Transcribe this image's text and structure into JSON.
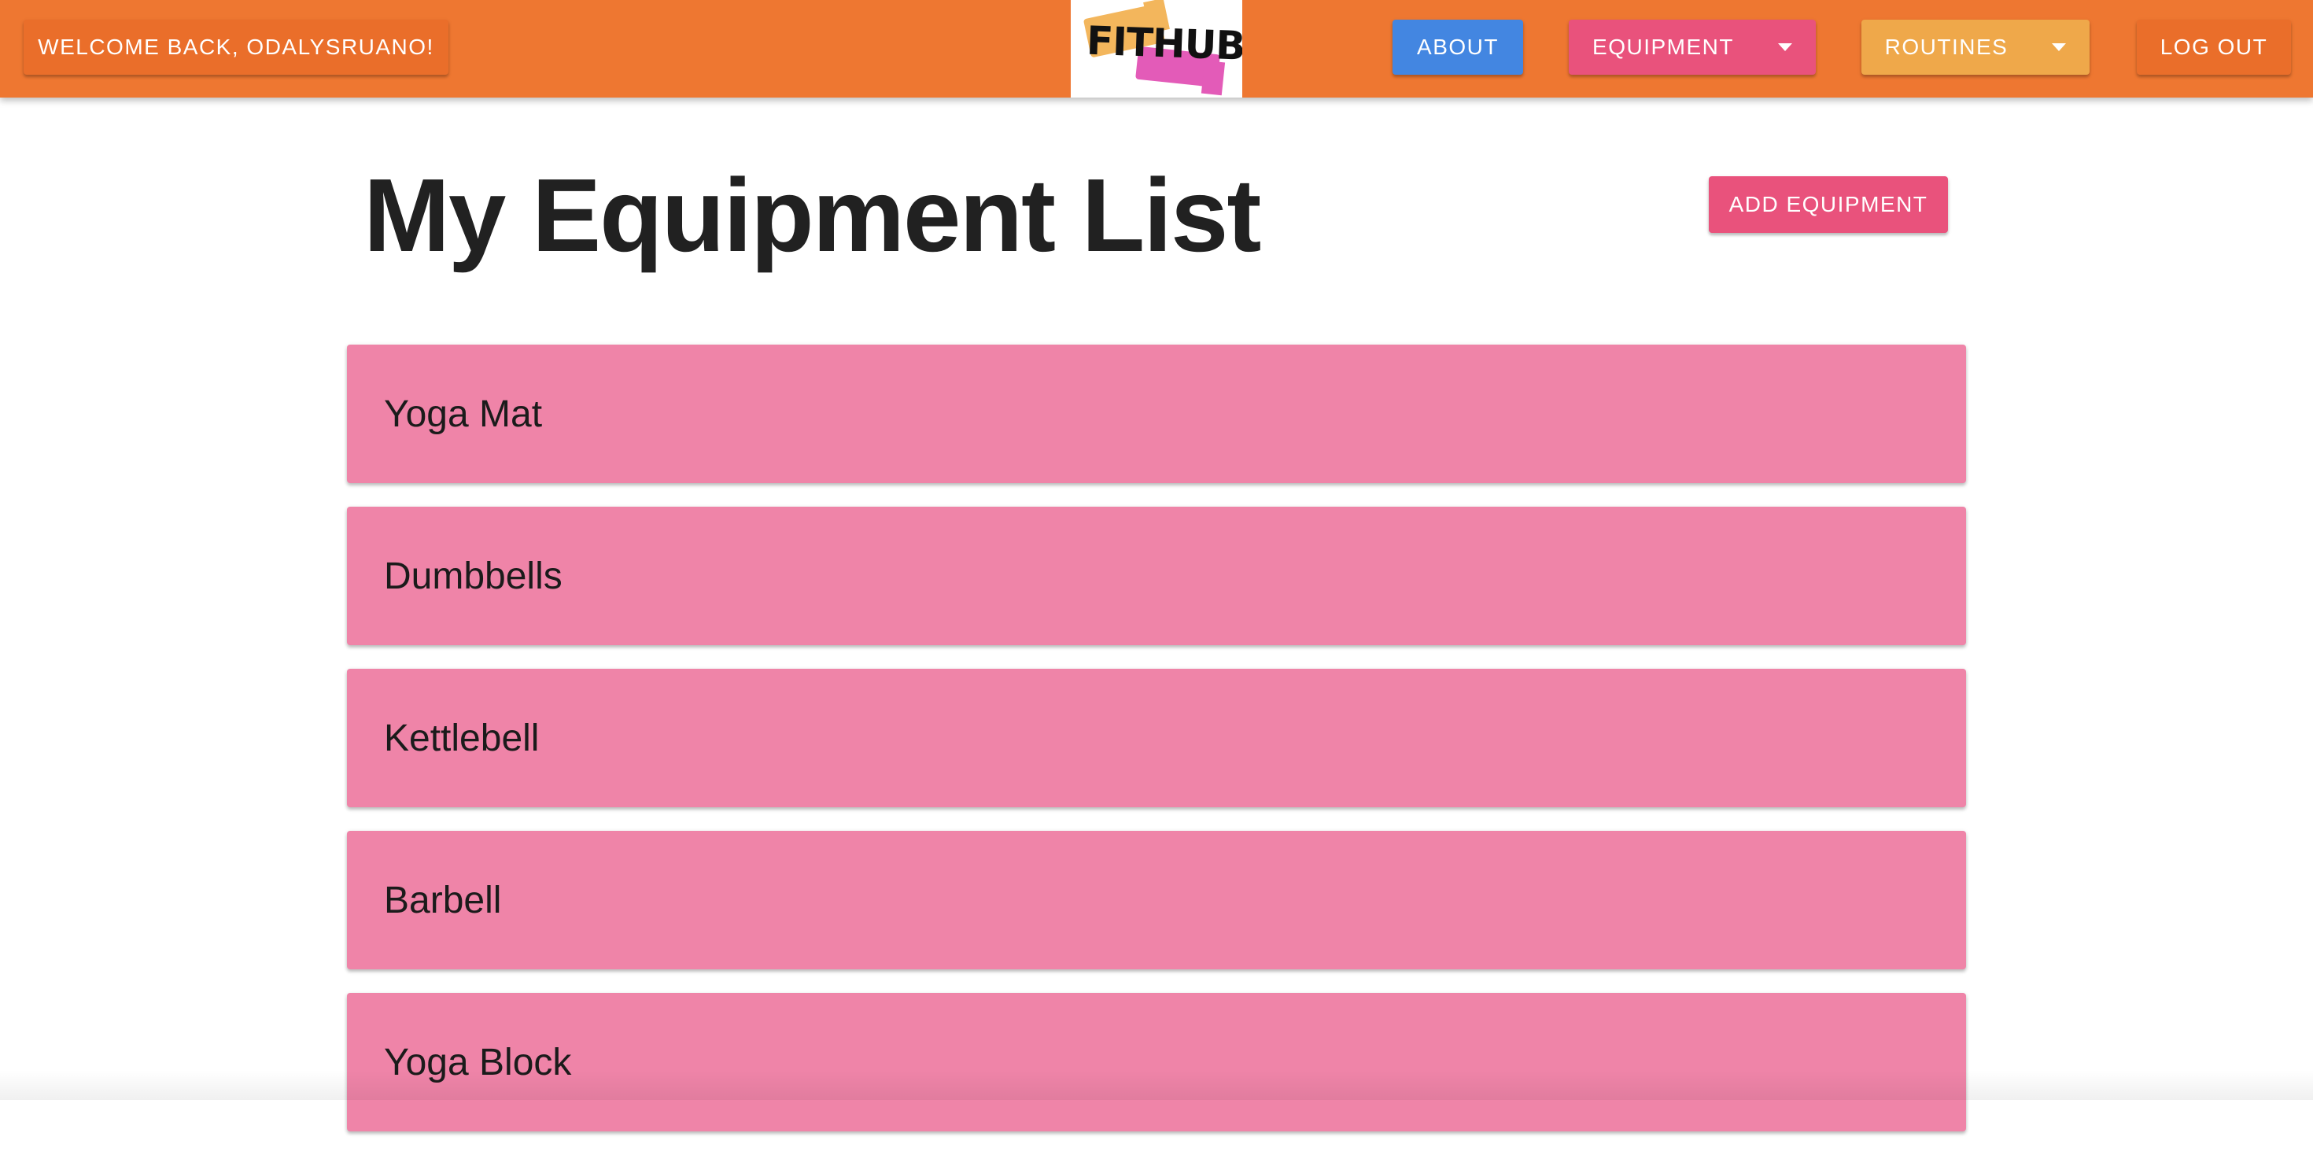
{
  "navbar": {
    "welcome_label": "WELCOME BACK, ODALYSRUANO!",
    "logo_text": "FITHUB",
    "about_label": "ABOUT",
    "equipment_label": "EQUIPMENT",
    "routines_label": "ROUTINES",
    "logout_label": "LOG OUT",
    "colors": {
      "bar": "#ee7731",
      "about": "#4386e1",
      "equipment": "#e9527c",
      "routines": "#efa84a"
    }
  },
  "main": {
    "title": "My Equipment List",
    "add_button_label": "ADD EQUIPMENT",
    "items": [
      {
        "label": "Yoga Mat"
      },
      {
        "label": "Dumbbells"
      },
      {
        "label": "Kettlebell"
      },
      {
        "label": "Barbell"
      },
      {
        "label": "Yoga Block"
      }
    ],
    "item_color": "#ef84a8"
  }
}
